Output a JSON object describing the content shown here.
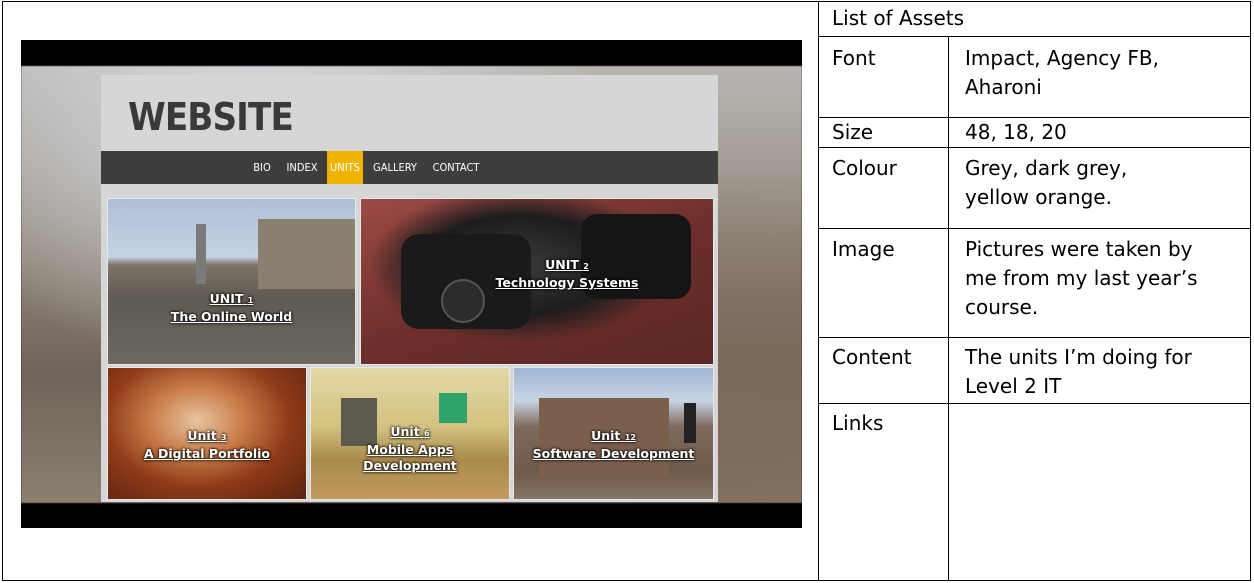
{
  "mockup": {
    "logo": "WEBSITE",
    "nav": [
      "BIO",
      "INDEX",
      "UNITS",
      "GALLERY",
      "CONTACT"
    ],
    "active_nav": "UNITS",
    "accent_color": "#f0b400",
    "tiles": [
      {
        "unit": "UNIT",
        "num": "1",
        "title": "The Online World"
      },
      {
        "unit": "UNIT",
        "num": "2",
        "title": "Technology Systems"
      },
      {
        "unit": "Unit",
        "num": "3",
        "title": "A Digital Portfolio"
      },
      {
        "unit": "Unit",
        "num": "6",
        "title": "Mobile Apps",
        "title2": "Development"
      },
      {
        "unit": "Unit",
        "num": "12",
        "title": "Software Development"
      }
    ]
  },
  "assets_table": {
    "heading": "List of Assets",
    "rows": [
      {
        "label": "Font",
        "value": "Impact, Agency FB,\nAharoni"
      },
      {
        "label": "Size",
        "value": "48, 18, 20"
      },
      {
        "label": "Colour",
        "value": "Grey, dark grey,\nyellow orange."
      },
      {
        "label": "Image",
        "value": "Pictures were taken by\nme from my last year’s\ncourse."
      },
      {
        "label": "Content",
        "value": "The units I’m doing for\nLevel 2 IT"
      },
      {
        "label": "Links",
        "value": ""
      }
    ]
  }
}
